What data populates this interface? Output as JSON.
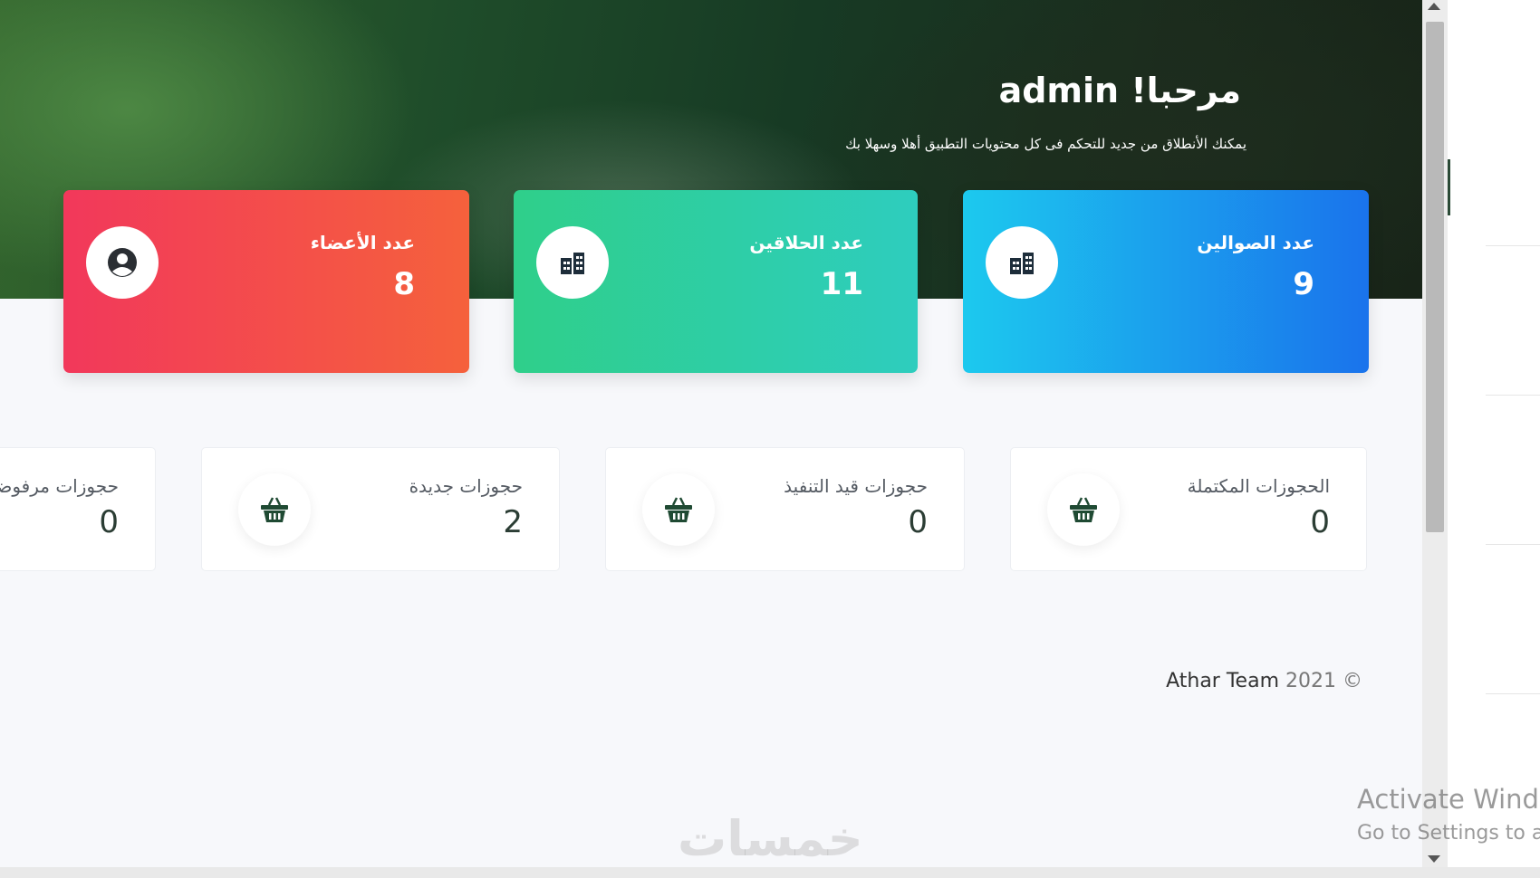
{
  "hero": {
    "title": "مرحبا! admin",
    "subtitle": "يمكنك الأنطلاق من جديد للتحكم فى كل محتويات التطبيق أهلا وسهلا بك"
  },
  "stats": [
    {
      "label": "عدد الصوالين",
      "value": "9",
      "icon": "building-icon"
    },
    {
      "label": "عدد الحلاقين",
      "value": "11",
      "icon": "building-icon"
    },
    {
      "label": "عدد الأعضاء",
      "value": "8",
      "icon": "user-circle-icon"
    }
  ],
  "bookings": [
    {
      "label": "الحجوزات المكتملة",
      "value": "0",
      "icon": "basket-icon"
    },
    {
      "label": "حجوزات قيد التنفيذ",
      "value": "0",
      "icon": "basket-icon"
    },
    {
      "label": "حجوزات جديدة",
      "value": "2",
      "icon": "basket-icon"
    },
    {
      "label": "حجوزات مرفوضة",
      "value": "0",
      "icon": "basket-icon"
    }
  ],
  "footer": {
    "team": "Athar Team",
    "year": "2021",
    "copyright": "©"
  },
  "overlay": {
    "activate_line1": "Activate Wind",
    "activate_line2": "Go to Settings to a",
    "watermark": "خمسات"
  },
  "colors": {
    "card_red": "#f2385b",
    "card_green": "#2fcf8a",
    "card_blue": "#1a73ec",
    "icon_dark_green": "#1f4a33",
    "hero_green": "#1f4d2a"
  }
}
